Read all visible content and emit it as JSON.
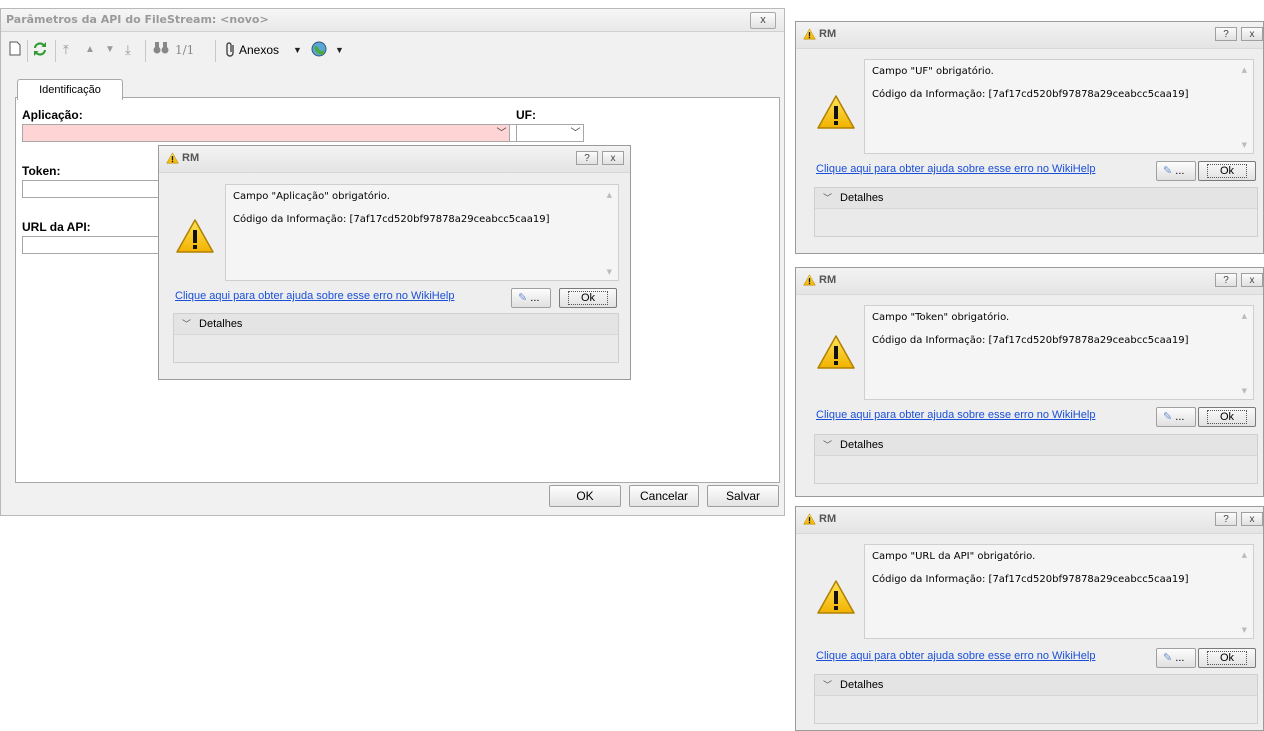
{
  "main": {
    "title": "Parâmetros da API do FileStream: <novo>",
    "close": "x",
    "toolbar": {
      "page_indicator": "1/1",
      "anexos": "Anexos"
    },
    "tab": "Identificação",
    "fields": {
      "aplicacao": "Aplicação:",
      "uf": "UF:",
      "token": "Token:",
      "url": "URL da API:"
    },
    "buttons": {
      "ok": "OK",
      "cancelar": "Cancelar",
      "salvar": "Salvar"
    }
  },
  "dialogs": [
    {
      "title": "RM",
      "help_btn": "?",
      "close_btn": "x",
      "message": "Campo \"Aplicação\" obrigatório.",
      "code": "Código da Informação: [7af17cd520bf97878a29ceabcc5caa19]",
      "link": "Clique aqui para obter ajuda sobre esse erro no WikiHelp",
      "dots": "...",
      "ok": "Ok",
      "details": "Detalhes"
    },
    {
      "title": "RM",
      "help_btn": "?",
      "close_btn": "x",
      "message": "Campo \"UF\" obrigatório.",
      "code": "Código da Informação: [7af17cd520bf97878a29ceabcc5caa19]",
      "link": "Clique aqui para obter ajuda sobre esse erro no WikiHelp",
      "dots": "...",
      "ok": "Ok",
      "details": "Detalhes"
    },
    {
      "title": "RM",
      "help_btn": "?",
      "close_btn": "x",
      "message": "Campo \"Token\" obrigatório.",
      "code": "Código da Informação: [7af17cd520bf97878a29ceabcc5caa19]",
      "link": "Clique aqui para obter ajuda sobre esse erro no WikiHelp",
      "dots": "...",
      "ok": "Ok",
      "details": "Detalhes"
    },
    {
      "title": "RM",
      "help_btn": "?",
      "close_btn": "x",
      "message": "Campo \"URL da API\" obrigatório.",
      "code": "Código da Informação: [7af17cd520bf97878a29ceabcc5caa19]",
      "link": "Clique aqui para obter ajuda sobre esse erro no WikiHelp",
      "dots": "...",
      "ok": "Ok",
      "details": "Detalhes"
    }
  ],
  "colors": {
    "required_field": "#ffd4d4",
    "link": "#1a4fd8",
    "warning": "#f5c400"
  }
}
